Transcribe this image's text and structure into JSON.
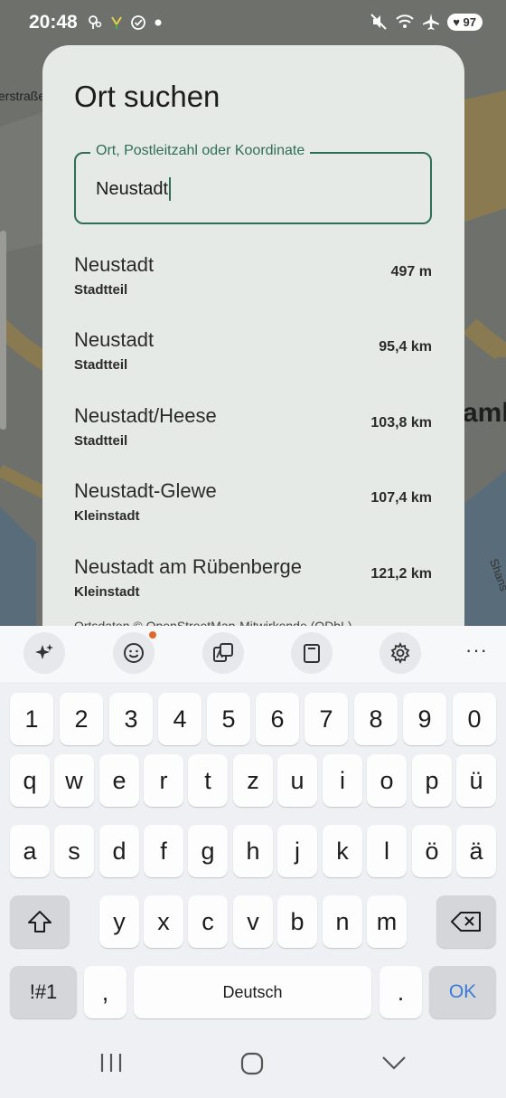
{
  "status_bar": {
    "time": "20:48",
    "battery": "97"
  },
  "map": {
    "street_label": "erstraße",
    "city_label": "amb",
    "side_label": "Shans"
  },
  "dialog": {
    "title": "Ort suchen",
    "field_label": "Ort, Postleitzahl oder Koordinate",
    "field_value": "Neustadt",
    "results": [
      {
        "name": "Neustadt",
        "type": "Stadtteil",
        "distance": "497 m"
      },
      {
        "name": "Neustadt",
        "type": "Stadtteil",
        "distance": "95,4 km"
      },
      {
        "name": "Neustadt/Heese",
        "type": "Stadtteil",
        "distance": "103,8 km"
      },
      {
        "name": "Neustadt-Glewe",
        "type": "Kleinstadt",
        "distance": "107,4 km"
      },
      {
        "name": "Neustadt am Rübenberge",
        "type": "Kleinstadt",
        "distance": "121,2 km"
      }
    ],
    "attribution": "Ortsdaten © OpenStreetMap-Mitwirkende (ODbL)"
  },
  "keyboard": {
    "toolbar_more": "···",
    "row_numbers": [
      "1",
      "2",
      "3",
      "4",
      "5",
      "6",
      "7",
      "8",
      "9",
      "0"
    ],
    "row_1": [
      "q",
      "w",
      "e",
      "r",
      "t",
      "z",
      "u",
      "i",
      "o",
      "p",
      "ü"
    ],
    "row_2": [
      "a",
      "s",
      "d",
      "f",
      "g",
      "h",
      "j",
      "k",
      "l",
      "ö",
      "ä"
    ],
    "row_3": [
      "y",
      "x",
      "c",
      "v",
      "b",
      "n",
      "m"
    ],
    "symbols_label": "!#1",
    "comma_label": ",",
    "space_label": "Deutsch",
    "period_label": ".",
    "ok_label": "OK"
  },
  "colors": {
    "accent": "#2f6e57",
    "dialog_bg": "#e6eae6",
    "keyboard_bg": "#eef0f3",
    "notification_dot": "#e0682a"
  }
}
